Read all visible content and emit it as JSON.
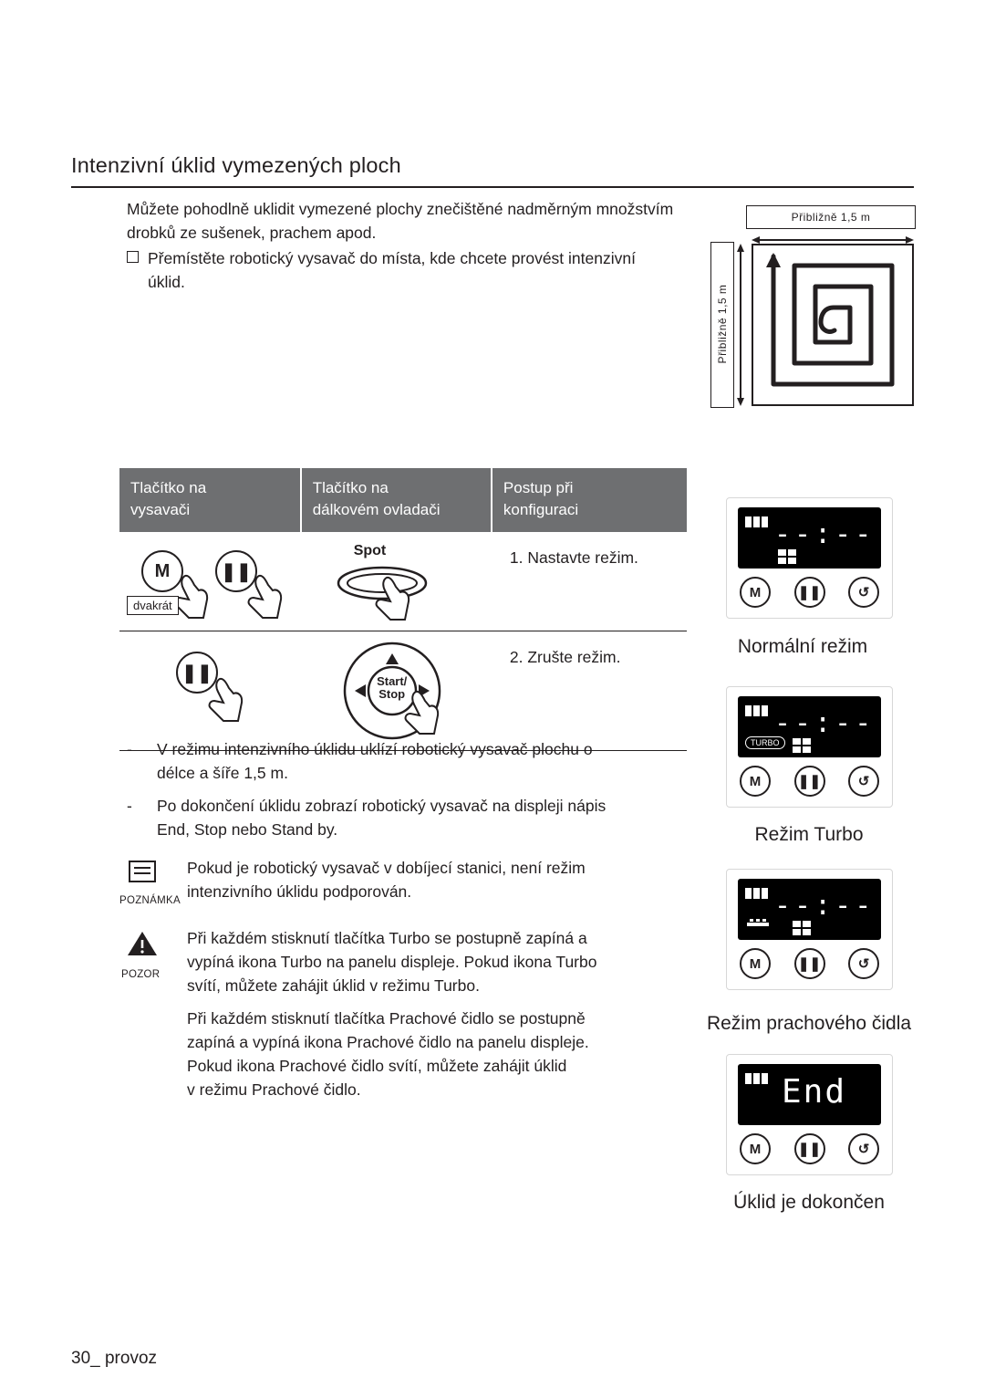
{
  "page": {
    "title": "Intenzivní úklid vymezených ploch",
    "footer": "30_ provoz"
  },
  "intro": {
    "line1": "Můžete pohodlně uklidit vymezené plochy znečištěné nadměrným množstvím",
    "line2": "drobků ze sušenek, prachem apod.",
    "bullet1": "Přemístěte robotický vysavač do místa, kde chcete provést intenzivní",
    "bullet1b": "úklid."
  },
  "diagram": {
    "dim_top": "Přibližně 1,5 m",
    "dim_left": "Přibližně 1,5 m"
  },
  "table": {
    "headers": [
      {
        "l1": "Tlačítko na",
        "l2": "vysavači"
      },
      {
        "l1": "Tlačítko na",
        "l2": "dálkovém ovladači"
      },
      {
        "l1": "Postup při",
        "l2": "konfiguraci"
      }
    ],
    "rows": [
      {
        "device_btn_m": "M",
        "device_btn_play": "❚❚",
        "device_note": "dvakrát",
        "remote_label": "Spot",
        "step": "1. Nastavte režim."
      },
      {
        "device_btn_play": "❚❚",
        "remote_label": "Start/\nStop",
        "step": "2. Zrušte režim."
      }
    ]
  },
  "notes": [
    {
      "dash": "-",
      "l1": "V režimu intenzivního úklidu uklízí robotický vysavač plochu o",
      "l2": "délce a šíře 1,5 m."
    },
    {
      "dash": "-",
      "l1": "Po dokončení úklidu zobrazí robotický vysavač na displeji nápis",
      "l2": "End, Stop nebo Stand by."
    }
  ],
  "poznamka": {
    "label": "POZNÁMKA",
    "l1": "Pokud je robotický vysavač v dobíjecí stanici, není režim",
    "l2": "intenzivního úklidu podporován."
  },
  "pozor": {
    "label": "POZOR",
    "p1_l1": "Při každém stisknutí tlačítka Turbo se postupně zapíná a",
    "p1_l2": "vypíná ikona Turbo na panelu displeje. Pokud ikona Turbo",
    "p1_l3": "svítí, můžete zahájit úklid v režimu Turbo.",
    "p2_l1": "Při každém stisknutí tlačítka Prachové čidlo se postupně",
    "p2_l2": "zapíná a vypíná ikona Prachové čidlo na panelu displeje.",
    "p2_l3": "Pokud ikona Prachové čidlo svítí, můžete zahájit úklid",
    "p2_l4": "v režimu Prachové čidlo."
  },
  "panels": [
    {
      "digits": "--:--",
      "caption": "Normální režim",
      "badge": "",
      "buttons": [
        "M",
        "❚❚",
        "↺"
      ]
    },
    {
      "digits": "--:--",
      "caption": "Režim Turbo",
      "badge": "TURBO",
      "buttons": [
        "M",
        "❚❚",
        "↺"
      ]
    },
    {
      "digits": "--:--",
      "caption": "Režim prachového čidla",
      "badge": "",
      "buttons": [
        "M",
        "❚❚",
        "↺"
      ]
    },
    {
      "digits": "End",
      "caption": "Úklid je dokončen",
      "badge": "",
      "buttons": [
        "M",
        "❚❚",
        "↺"
      ]
    }
  ]
}
